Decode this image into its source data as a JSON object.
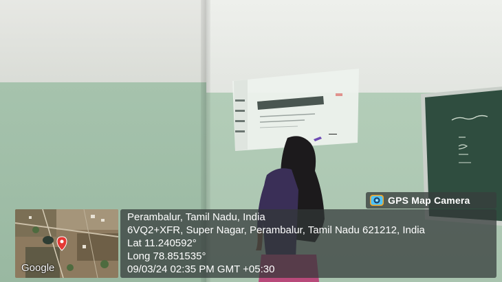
{
  "overlay": {
    "badge_label": "GPS Map Camera",
    "map_logo": "Google",
    "location_title": "Perambalur, Tamil Nadu, India",
    "address": "6VQ2+XFR, Super Nagar, Perambalur, Tamil Nadu 621212, India",
    "latitude": "Lat 11.240592°",
    "longitude": "Long 78.851535°",
    "timestamp": "09/03/24 02:35 PM GMT +05:30"
  },
  "colors": {
    "wall_green": "#a9c4af",
    "wall_white": "#e6e8e3",
    "board_green": "#2f4d3f",
    "map_pin": "#e53935",
    "overlay_bg": "#323837"
  },
  "icons": {
    "badge_icon": "camera-lens-icon",
    "map_marker": "map-pin-icon"
  }
}
